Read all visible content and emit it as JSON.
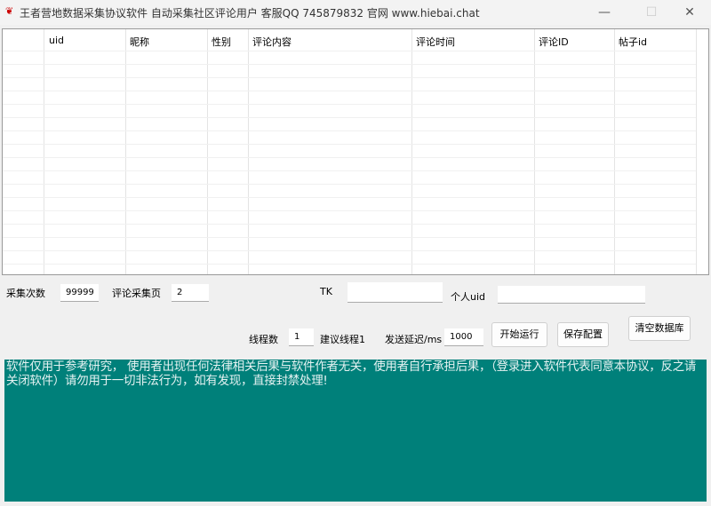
{
  "window": {
    "title": "王者营地数据采集协议软件 自动采集社区评论用户 客服QQ 745879832 官网 www.hiebai.chat",
    "minimize": "—",
    "maximize": "☐",
    "close": "✕"
  },
  "table": {
    "columns": [
      "uid",
      "昵称",
      "性别",
      "评论内容",
      "评论时间",
      "评论ID",
      "帖子id"
    ]
  },
  "form": {
    "collect_count_label": "采集次数",
    "collect_count": "99999",
    "comment_pages_label": "评论采集页",
    "comment_pages": "2",
    "tk_label": "TK",
    "tk": "",
    "uid_label": "个人uid",
    "uid": "",
    "threads_label": "线程数",
    "threads": "1",
    "threads_hint": "建议线程1",
    "delay_label": "发送延迟/ms",
    "delay": "1000"
  },
  "buttons": {
    "start": "开始运行",
    "save": "保存配置",
    "clear": "清空数据库"
  },
  "log": {
    "text": "软件仅用于参考研究， 使用者出现任何法律相关后果与软件作者无关，使用者自行承担后果，（登录进入软件代表同意本协议，反之请关闭软件）请勿用于一切非法行为，如有发现，直接封禁处理!"
  }
}
